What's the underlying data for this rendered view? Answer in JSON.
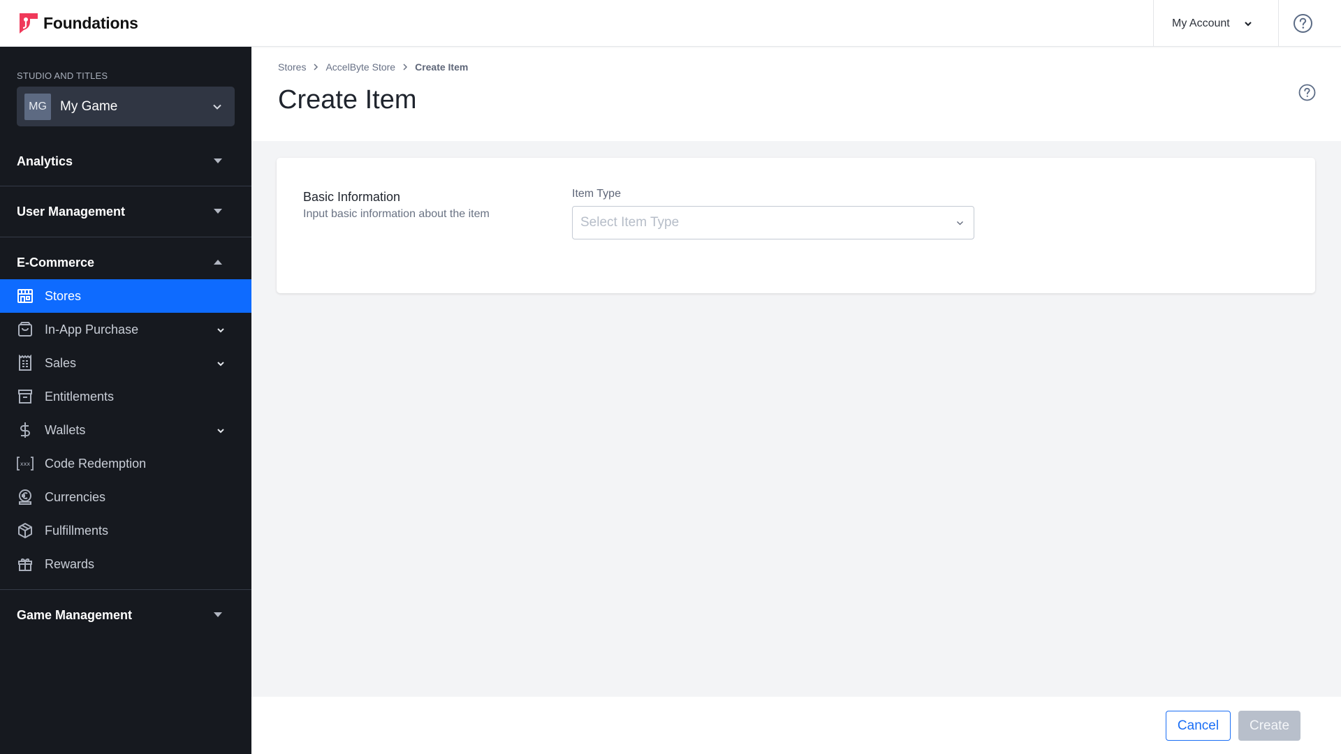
{
  "header": {
    "brand": "Foundations",
    "account_label": "My Account",
    "help_icon": "help-circle-icon"
  },
  "sidebar": {
    "studio_label": "STUDIO AND TITLES",
    "studio": {
      "avatar": "MG",
      "name": "My Game"
    },
    "groups": [
      {
        "label": "Analytics",
        "expanded": false
      },
      {
        "label": "User Management",
        "expanded": false
      },
      {
        "label": "E-Commerce",
        "expanded": true
      },
      {
        "label": "Game Management",
        "expanded": false
      }
    ],
    "ecommerce_items": [
      {
        "label": "Stores",
        "icon": "store-icon",
        "active": true,
        "has_children": false
      },
      {
        "label": "In-App Purchase",
        "icon": "shopping-bag-icon",
        "active": false,
        "has_children": true
      },
      {
        "label": "Sales",
        "icon": "receipt-icon",
        "active": false,
        "has_children": true
      },
      {
        "label": "Entitlements",
        "icon": "archive-icon",
        "active": false,
        "has_children": false
      },
      {
        "label": "Wallets",
        "icon": "dollar-icon",
        "active": false,
        "has_children": true
      },
      {
        "label": "Code Redemption",
        "icon": "code-brackets-icon",
        "active": false,
        "has_children": false
      },
      {
        "label": "Currencies",
        "icon": "coin-euro-icon",
        "active": false,
        "has_children": false
      },
      {
        "label": "Fulfillments",
        "icon": "box-icon",
        "active": false,
        "has_children": false
      },
      {
        "label": "Rewards",
        "icon": "gift-icon",
        "active": false,
        "has_children": false
      }
    ]
  },
  "page": {
    "breadcrumb": [
      "Stores",
      "AccelByte Store",
      "Create Item"
    ],
    "title": "Create Item"
  },
  "form": {
    "section_title": "Basic Information",
    "section_description": "Input basic information about the item",
    "item_type": {
      "label": "Item Type",
      "placeholder": "Select Item Type",
      "value": ""
    }
  },
  "footer": {
    "cancel_label": "Cancel",
    "create_label": "Create",
    "create_disabled": true
  },
  "colors": {
    "brand": "#f0395a",
    "accent": "#0e6bff",
    "sidebar_bg": "#16191f",
    "disabled_button": "#b8bfcb"
  }
}
